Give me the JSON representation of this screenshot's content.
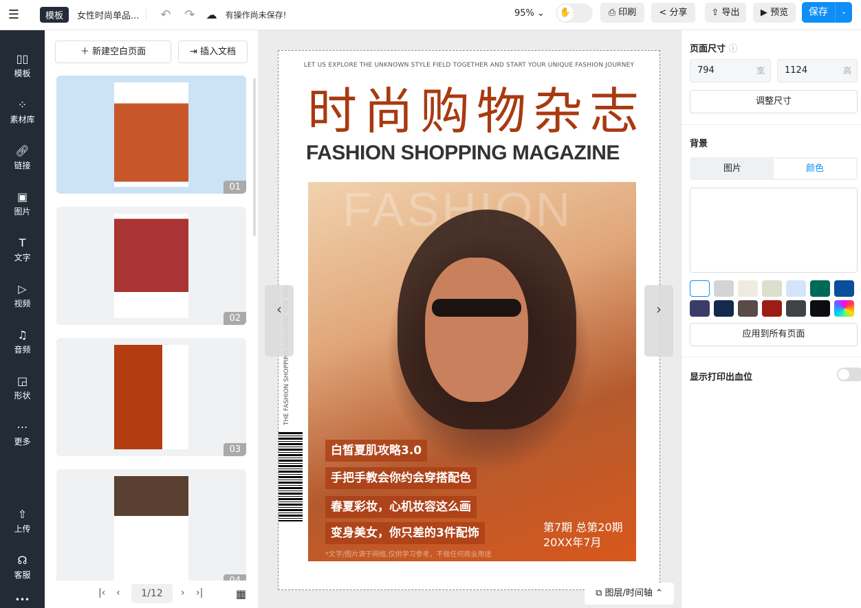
{
  "topbar": {
    "menu_icon": "hamburger-icon",
    "mode_badge": "模板",
    "doc_title": "女性时尚单品...",
    "status": "有操作尚未保存!",
    "zoom": "95%",
    "print": "印刷",
    "share": "分享",
    "export": "导出",
    "preview": "预览",
    "save": "保存"
  },
  "sidebar": {
    "items": [
      {
        "label": "模板",
        "icon": "template-icon"
      },
      {
        "label": "素材库",
        "icon": "assets-icon"
      },
      {
        "label": "链接",
        "icon": "link-icon"
      },
      {
        "label": "图片",
        "icon": "image-icon"
      },
      {
        "label": "文字",
        "icon": "text-icon"
      },
      {
        "label": "视频",
        "icon": "video-icon"
      },
      {
        "label": "音频",
        "icon": "audio-icon"
      },
      {
        "label": "形状",
        "icon": "shape-icon"
      },
      {
        "label": "更多",
        "icon": "more-icon"
      },
      {
        "label": "上传",
        "icon": "upload-icon"
      },
      {
        "label": "客服",
        "icon": "support-icon"
      }
    ]
  },
  "pages_panel": {
    "new_page": "新建空白页面",
    "insert_doc": "插入文档",
    "pages": [
      {
        "num": "01",
        "selected": true
      },
      {
        "num": "02"
      },
      {
        "num": "03"
      },
      {
        "num": "04"
      }
    ],
    "pager": "1/12"
  },
  "canvas": {
    "tagline": "LET US EXPLORE THE UNKNOWN STYLE FIELD TOGETHER AND START YOUR UNIQUE FASHION JOURNEY",
    "title_cn": "时尚购物杂志",
    "title_en": "FASHION SHOPPING MAGAZINE",
    "bg_word": "FASHION",
    "vertical_text": "THE FASHION SHOPPING MAGAZINE FOR YOU",
    "headlines": [
      "白皙夏肌攻略3.0",
      "手把手教会你约会穿搭配色",
      "春夏彩妆，心机妆容这么画",
      "变身美女，你只差的3件配饰"
    ],
    "issue_line1": "第7期 总第20期",
    "issue_line2": "20XX年7月",
    "disclaimer": "*文字/图片源于网络,仅供学习参考，不做任何商业用途",
    "layers_button": "图层/时间轴",
    "accent": "#a83a10"
  },
  "right_panel": {
    "page_size_label": "页面尺寸",
    "width": "794",
    "width_unit": "宽",
    "height": "1124",
    "height_unit": "高",
    "resize": "调整尺寸",
    "background_label": "背景",
    "tab_image": "图片",
    "tab_color": "颜色",
    "swatches": [
      "#ffffff",
      "#d4d4d4",
      "#efebe0",
      "#dbdfcc",
      "#d3e4fb",
      "#006a58",
      "#0a4f9c",
      "#3a3c6a",
      "#142a4c",
      "#5a4a48",
      "#9c1c16",
      "#404346",
      "#0c0d10",
      "gradient"
    ],
    "apply_all": "应用到所有页面",
    "bleed_label": "显示打印出血位",
    "bleed_on": false
  }
}
